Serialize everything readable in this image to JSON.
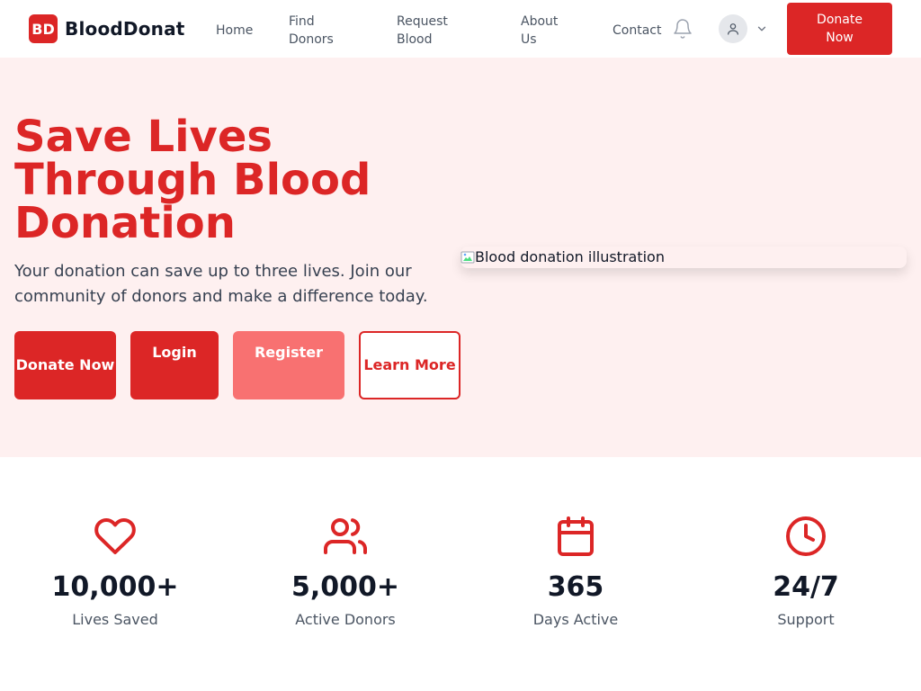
{
  "brand": {
    "badge": "BD",
    "name": "BloodDonat"
  },
  "nav": {
    "home": "Home",
    "find_donors": "Find Donors",
    "request_blood": "Request Blood",
    "about_us": "About Us",
    "contact": "Contact",
    "donate_now": "Donate Now"
  },
  "icons": {
    "notifications": "bell-icon",
    "user": "user-icon",
    "menu": "chevron-down-icon"
  },
  "hero": {
    "title": "Save Lives Through Blood Donation",
    "subtitle": "Your donation can save up to three lives. Join our community of donors and make a difference today.",
    "buttons": {
      "donate_now": "Donate Now",
      "login": "Login",
      "register": "Register",
      "learn_more": "Learn More"
    },
    "image_alt": "Blood donation illustration"
  },
  "stats": [
    {
      "icon": "heart-icon",
      "value": "10,000+",
      "label": "Lives Saved"
    },
    {
      "icon": "users-icon",
      "value": "5,000+",
      "label": "Active Donors"
    },
    {
      "icon": "calendar-icon",
      "value": "365",
      "label": "Days Active"
    },
    {
      "icon": "clock-icon",
      "value": "24/7",
      "label": "Support"
    }
  ],
  "colors": {
    "primary": "#dc2626",
    "primary_light": "#f87171",
    "hero_background": "#fef0f0",
    "text_dark": "#111827",
    "text_muted": "#4b5563"
  }
}
